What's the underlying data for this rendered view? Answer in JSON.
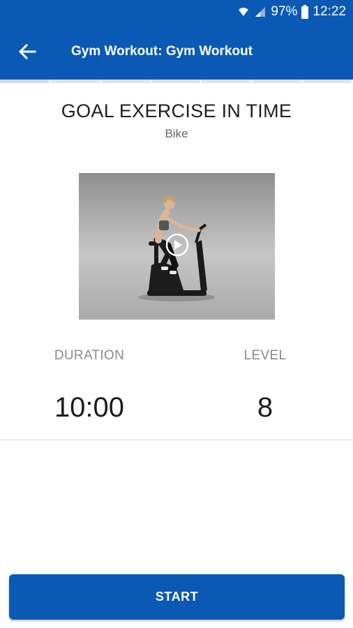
{
  "status_bar": {
    "battery": "97%",
    "time": "12:22",
    "icons": [
      "wifi-icon",
      "signal-icon",
      "battery-icon"
    ]
  },
  "app_bar": {
    "back_icon": "arrow-left-icon",
    "title": "Gym Workout: Gym Workout"
  },
  "exercise": {
    "title": "GOAL EXERCISE IN TIME",
    "subtitle": "Bike",
    "video_icon": "play-icon"
  },
  "stats": {
    "duration_label": "DURATION",
    "duration_value": "10:00",
    "level_label": "LEVEL",
    "level_value": "8"
  },
  "actions": {
    "start_label": "START"
  },
  "colors": {
    "primary": "#0a5ab5",
    "text": "#1f1f1f",
    "muted": "#8a8a8a"
  }
}
